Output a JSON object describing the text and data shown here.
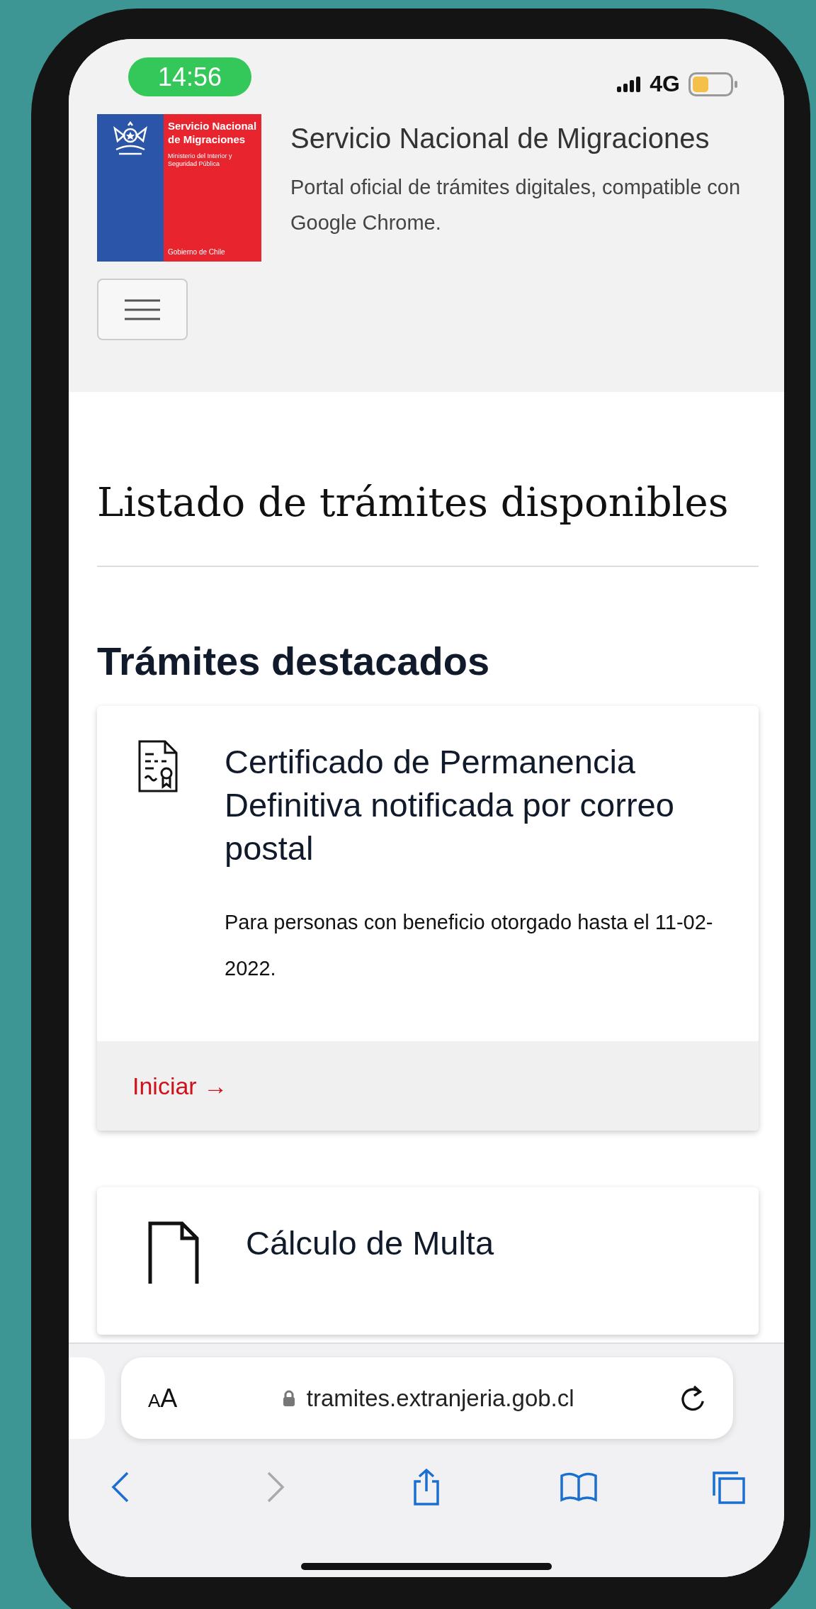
{
  "status_bar": {
    "time": "14:56",
    "network": "4G"
  },
  "header": {
    "logo": {
      "title": "Servicio Nacional de Migraciones",
      "ministry": "Ministerio del Interior y Seguridad Pública",
      "footer": "Gobierno de Chile"
    },
    "site_title": "Servicio Nacional de Migraciones",
    "site_subtitle": "Portal oficial de trámites digitales, compatible con Google Chrome."
  },
  "page_title": "Listado de trámites disponibles",
  "section_title": "Trámites destacados",
  "cards": [
    {
      "kind": "certificate",
      "title": "Certificado de Permanencia Definitiva notificada por correo postal",
      "description": "Para personas con beneficio otorgado hasta el 11-02-2022.",
      "action": "Iniciar →"
    },
    {
      "kind": "document",
      "title": "Cálculo de Multa"
    }
  ],
  "browser": {
    "text_size": "AA",
    "url": "tramites.extranjeria.gob.cl",
    "nav": [
      {
        "kind": "back",
        "disabled": false
      },
      {
        "kind": "forward",
        "disabled": true
      },
      {
        "kind": "share",
        "disabled": false
      },
      {
        "kind": "bookmarks",
        "disabled": false
      },
      {
        "kind": "tabs",
        "disabled": false
      }
    ]
  }
}
